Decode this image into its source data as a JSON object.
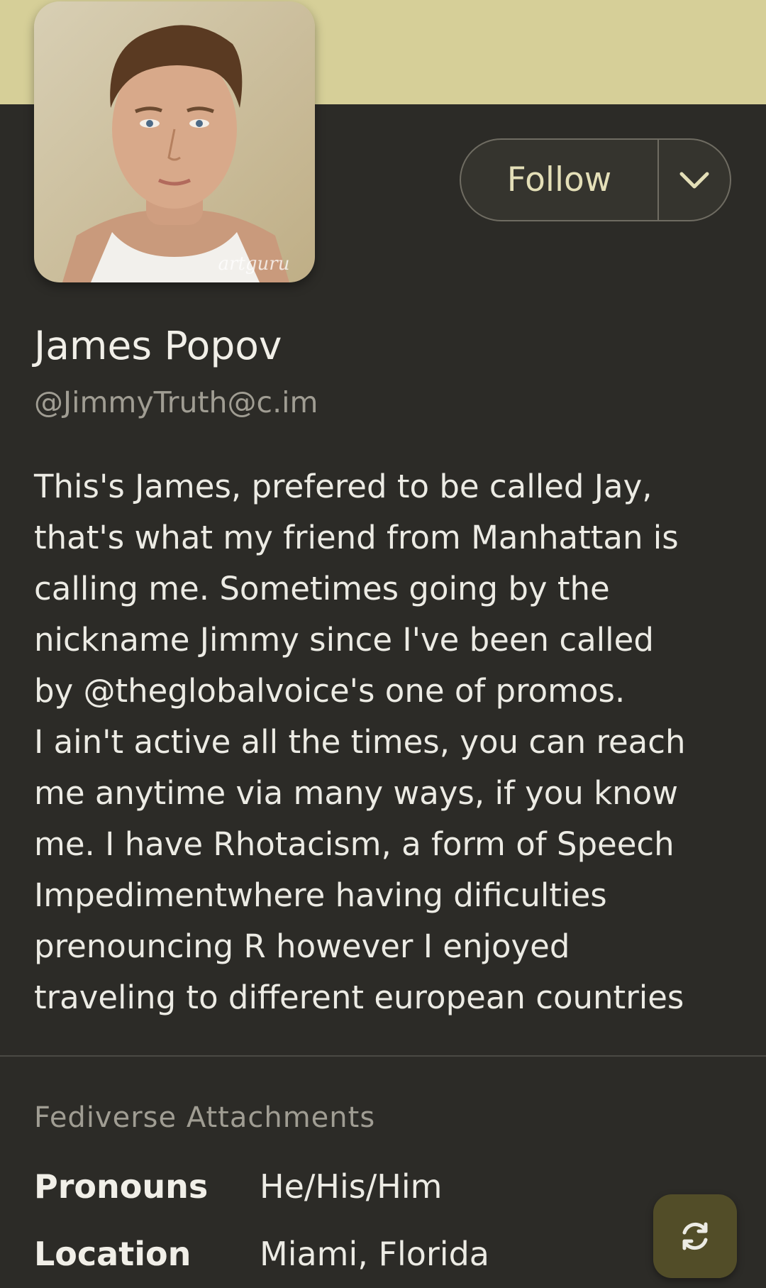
{
  "profile": {
    "display_name": "James Popov",
    "handle": "@JimmyTruth@c.im",
    "avatar_watermark": "artguru",
    "bio_lines": [
      "This's James, prefered to be called Jay,",
      "that's what my friend from Manhattan is",
      "calling me. Sometimes going by the",
      "nickname Jimmy since I've been called",
      "by @theglobalvoice's one of promos.",
      "I ain't active all the times, you can reach",
      "me anytime via many ways, if you know",
      "me. I have Rhotacism, a form of Speech",
      "Impedimentwhere having dificulties",
      "prenouncing R however I enjoyed",
      "traveling to different european countries"
    ]
  },
  "actions": {
    "follow_label": "Follow",
    "more_icon": "chevron-down-icon",
    "refresh_icon": "refresh-icon"
  },
  "attachments": {
    "title": "Fediverse Attachments",
    "fields": [
      {
        "label": "Pronouns",
        "value": "He/His/Him"
      },
      {
        "label": "Location",
        "value": "Miami, Florida"
      }
    ]
  },
  "colors": {
    "banner": "#d6cf98",
    "background": "#2c2b27",
    "accent": "#e4dfb8",
    "fab": "#524d28"
  }
}
